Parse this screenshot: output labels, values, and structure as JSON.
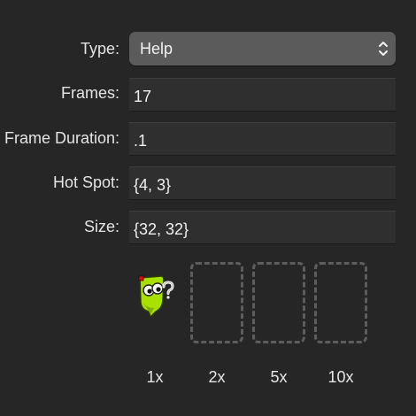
{
  "form": {
    "type_label": "Type:",
    "type_value": "Help",
    "frames_label": "Frames:",
    "frames_value": "17",
    "frame_duration_label": "Frame Duration:",
    "frame_duration_value": ".1",
    "hot_spot_label": "Hot Spot:",
    "hot_spot_value": "{4, 3}",
    "size_label": "Size:",
    "size_value": "{32, 32}"
  },
  "scales": [
    "1x",
    "2x",
    "5x",
    "10x"
  ],
  "icons": {
    "popup_arrows": "up-down-chevron-icon",
    "cursor_preview": "help-cursor-icon"
  },
  "colors": {
    "background": "#262626",
    "popup": "#5b5b5b",
    "field": "#2f2f2f",
    "well_border": "#5d5d5d",
    "cursor_green": "#a8e000"
  }
}
